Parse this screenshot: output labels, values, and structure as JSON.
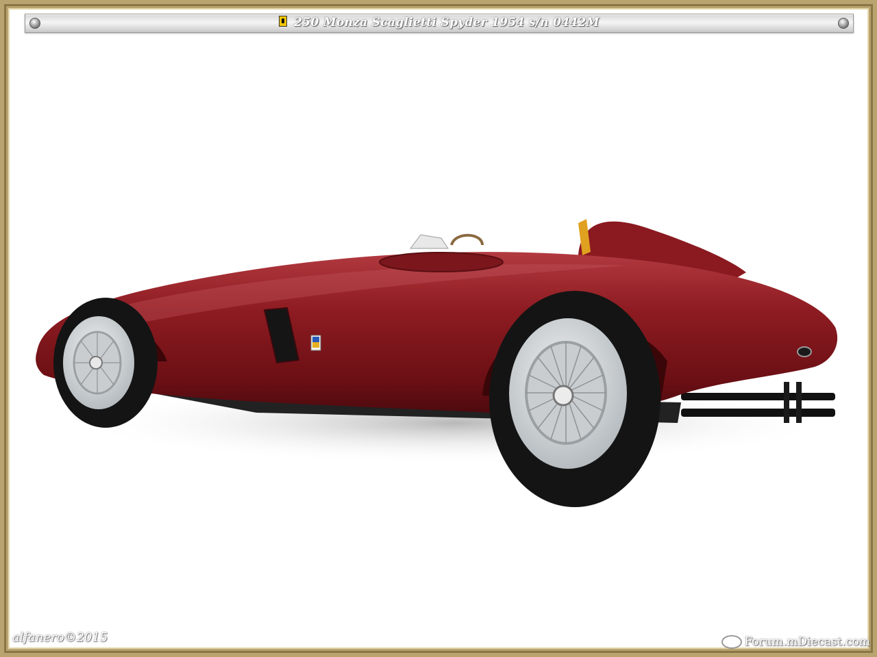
{
  "header": {
    "title": "250 Monza Scaglietti Spyder 1954  s/n 0442M"
  },
  "photo": {
    "subject": "",
    "colors": {
      "body": "#7d1218",
      "frame": "#b9a36e",
      "wheel": "#d8dcdf",
      "tyre": "#141414"
    }
  },
  "footer": {
    "signature": "alfanero©2015",
    "watermark": "Forum.mDiecast.com"
  }
}
